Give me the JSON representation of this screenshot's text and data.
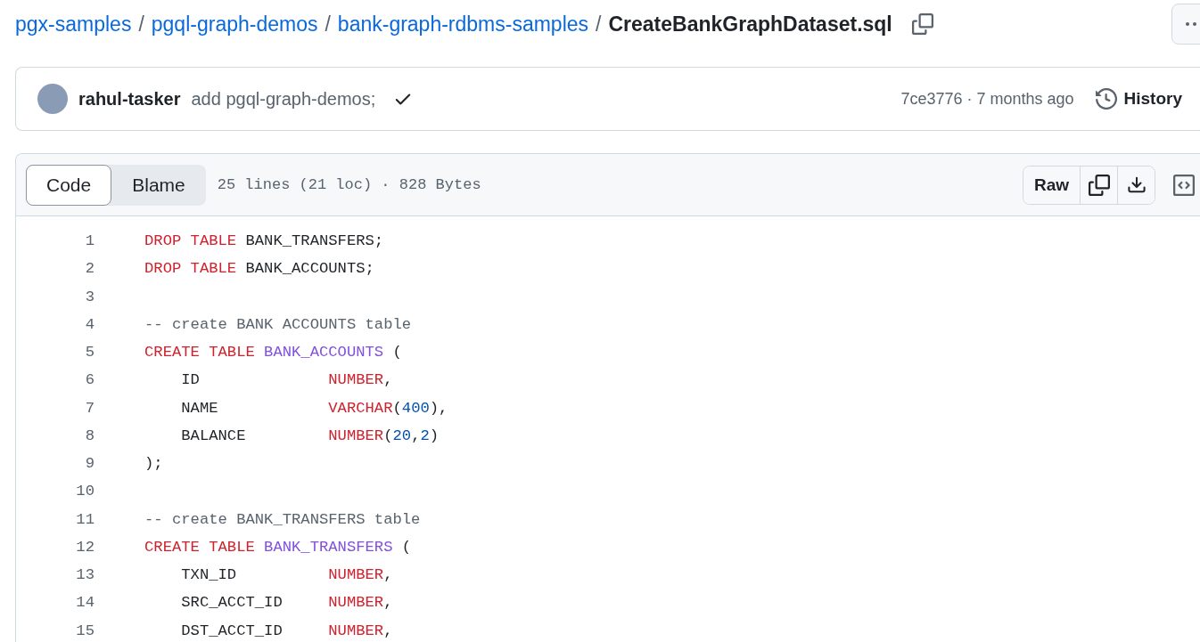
{
  "breadcrumb": {
    "links": [
      "pgx-samples",
      "pgql-graph-demos",
      "bank-graph-rdbms-samples"
    ],
    "separator": "/",
    "file": "CreateBankGraphDataset.sql"
  },
  "commit": {
    "author": "rahul-tasker",
    "message": "add pgql-graph-demos;",
    "hash_time": "7ce3776 · 7 months ago",
    "history": "History"
  },
  "file": {
    "tabs": [
      {
        "label": "Code",
        "selected": true
      },
      {
        "label": "Blame",
        "selected": false
      }
    ],
    "info": "25 lines (21 loc) · 828 Bytes",
    "raw": "Raw"
  },
  "lines": [
    {
      "number": "1",
      "tokens": [
        {
          "kind": "keyword",
          "text": "DROP TABLE"
        },
        {
          "kind": "plain",
          "text": " BANK_TRANSFERS;"
        }
      ]
    },
    {
      "number": "2",
      "tokens": [
        {
          "kind": "keyword",
          "text": "DROP TABLE"
        },
        {
          "kind": "plain",
          "text": " BANK_ACCOUNTS;"
        }
      ]
    },
    {
      "number": "3"
    },
    {
      "number": "4",
      "tokens": [
        {
          "kind": "comment",
          "text": "-- create BANK ACCOUNTS table"
        }
      ]
    },
    {
      "number": "5",
      "tokens": [
        {
          "kind": "keyword",
          "text": "CREATE TABLE "
        },
        {
          "kind": "entity",
          "text": "BANK_ACCOUNTS"
        },
        {
          "kind": "plain",
          "text": " ("
        }
      ]
    },
    {
      "number": "6",
      "tokens": [
        {
          "kind": "plain",
          "text": "    ID              "
        },
        {
          "kind": "keyword",
          "text": "NUMBER"
        },
        {
          "kind": "plain",
          "text": ","
        }
      ]
    },
    {
      "number": "7",
      "tokens": [
        {
          "kind": "plain",
          "text": "    NAME            "
        },
        {
          "kind": "keyword",
          "text": "VARCHAR"
        },
        {
          "kind": "plain",
          "text": "("
        },
        {
          "kind": "number",
          "text": "400"
        },
        {
          "kind": "plain",
          "text": "),"
        }
      ]
    },
    {
      "number": "8",
      "tokens": [
        {
          "kind": "plain",
          "text": "    BALANCE         "
        },
        {
          "kind": "keyword",
          "text": "NUMBER"
        },
        {
          "kind": "plain",
          "text": "("
        },
        {
          "kind": "number",
          "text": "20"
        },
        {
          "kind": "plain",
          "text": ","
        },
        {
          "kind": "number",
          "text": "2"
        },
        {
          "kind": "plain",
          "text": ")"
        }
      ]
    },
    {
      "number": "9",
      "tokens": [
        {
          "kind": "plain",
          "text": ");"
        }
      ]
    },
    {
      "number": "10"
    },
    {
      "number": "11",
      "tokens": [
        {
          "kind": "comment",
          "text": "-- create BANK_TRANSFERS table"
        }
      ]
    },
    {
      "number": "12",
      "tokens": [
        {
          "kind": "keyword",
          "text": "CREATE TABLE "
        },
        {
          "kind": "entity",
          "text": "BANK_TRANSFERS"
        },
        {
          "kind": "plain",
          "text": " ("
        }
      ]
    },
    {
      "number": "13",
      "tokens": [
        {
          "kind": "plain",
          "text": "    TXN_ID          "
        },
        {
          "kind": "keyword",
          "text": "NUMBER"
        },
        {
          "kind": "plain",
          "text": ","
        }
      ]
    },
    {
      "number": "14",
      "tokens": [
        {
          "kind": "plain",
          "text": "    SRC_ACCT_ID     "
        },
        {
          "kind": "keyword",
          "text": "NUMBER"
        },
        {
          "kind": "plain",
          "text": ","
        }
      ]
    },
    {
      "number": "15",
      "tokens": [
        {
          "kind": "plain",
          "text": "    DST_ACCT_ID     "
        },
        {
          "kind": "keyword",
          "text": "NUMBER"
        },
        {
          "kind": "plain",
          "text": ","
        }
      ]
    }
  ]
}
